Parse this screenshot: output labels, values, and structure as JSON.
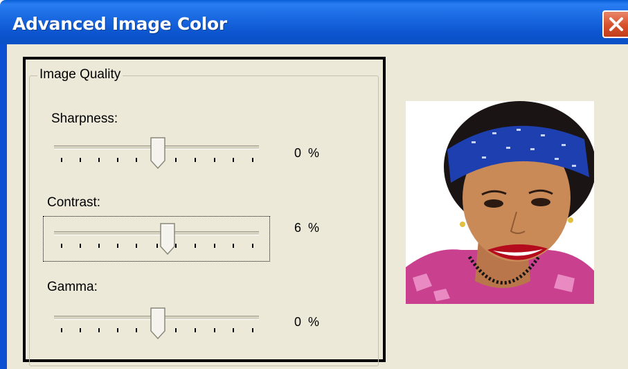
{
  "window": {
    "title": "Advanced Image Color"
  },
  "group": {
    "title": "Image Quality"
  },
  "sliders": [
    {
      "label": "Sharpness:",
      "value": "0",
      "unit": "%"
    },
    {
      "label": "Contrast:",
      "value": "6",
      "unit": "%"
    },
    {
      "label": "Gamma:",
      "value": "0",
      "unit": "%"
    }
  ],
  "icons": {
    "close": "close-icon"
  },
  "colors": {
    "titlebar": "#0a5fd8",
    "dialog_bg": "#ece9d8",
    "close_button": "#d6512c"
  }
}
